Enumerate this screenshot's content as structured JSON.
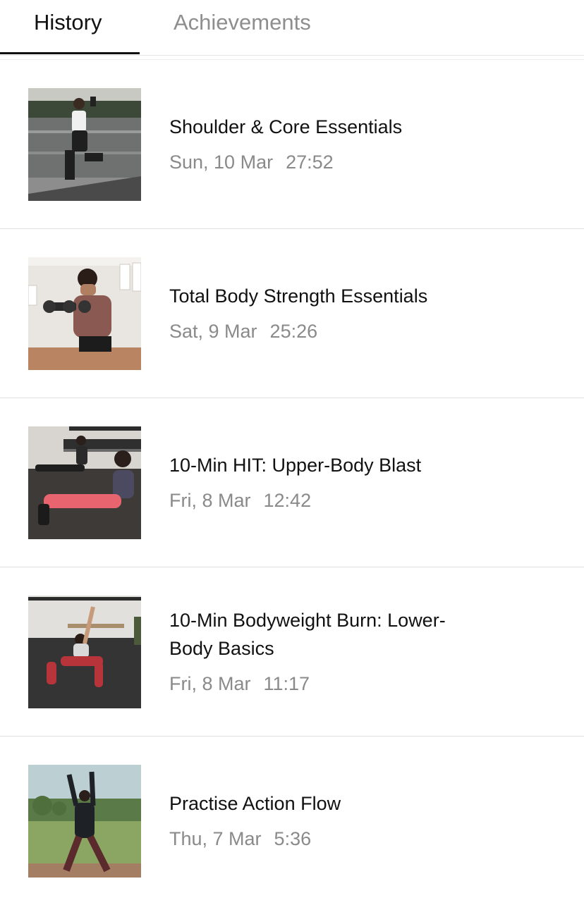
{
  "tabs": {
    "history": "History",
    "achievements": "Achievements",
    "active": "history"
  },
  "workouts": [
    {
      "title": "Shoulder & Core Essentials",
      "date": "Sun, 10 Mar",
      "duration": "27:52"
    },
    {
      "title": "Total Body Strength Essentials",
      "date": "Sat, 9 Mar",
      "duration": "25:26"
    },
    {
      "title": "10-Min HIT: Upper-Body Blast",
      "date": "Fri, 8 Mar",
      "duration": "12:42"
    },
    {
      "title": "10-Min Bodyweight Burn: Lower-Body Basics",
      "date": "Fri, 8 Mar",
      "duration": "11:17"
    },
    {
      "title": "Practise Action Flow",
      "date": "Thu, 7 Mar",
      "duration": "5:36"
    }
  ],
  "colors": {
    "text_primary": "#111111",
    "text_secondary": "#8a8a8a",
    "tab_inactive": "#8e8e8e",
    "divider": "#e2e2e2"
  }
}
